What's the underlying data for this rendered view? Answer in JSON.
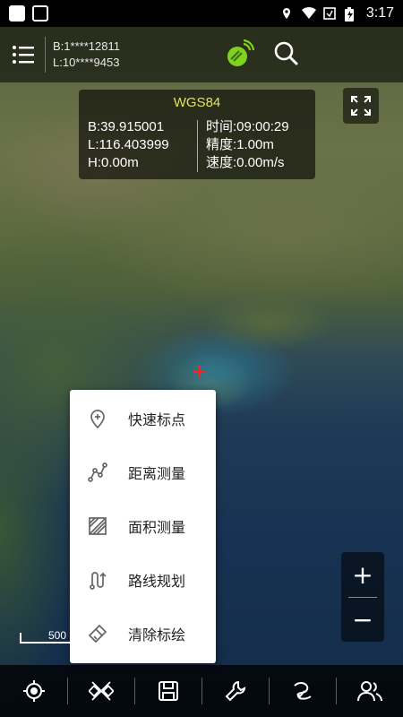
{
  "status_bar": {
    "time": "3:17",
    "icons": [
      "gallery-icon",
      "image-icon",
      "location-icon",
      "wifi-icon",
      "sim-icon",
      "battery-icon"
    ]
  },
  "top_bar": {
    "coord_b": "B:1****12811",
    "coord_l": "L:10****9453",
    "icons": [
      "menu-icon",
      "gps-signal-icon",
      "search-icon"
    ],
    "accent_color": "#7ed321"
  },
  "info_panel": {
    "datum": "WGS84",
    "latitude": "B:39.915001",
    "longitude": "L:116.403999",
    "height": "H:0.00m",
    "time": "时间:09:00:29",
    "accuracy": "精度:1.00m",
    "speed": "速度:0.00m/s",
    "title_color": "#e6e15a"
  },
  "popup_menu": {
    "items": [
      {
        "label": "快速标点",
        "icon": "pin-add-icon"
      },
      {
        "label": "距离测量",
        "icon": "distance-measure-icon"
      },
      {
        "label": "面积测量",
        "icon": "area-measure-icon"
      },
      {
        "label": "路线规划",
        "icon": "route-plan-icon"
      },
      {
        "label": "清除标绘",
        "icon": "clear-brush-icon"
      }
    ]
  },
  "zoom": {
    "in_label": "+",
    "out_label": "−"
  },
  "scale": {
    "label": "500"
  },
  "bottom_bar": {
    "icons": [
      "locate-icon",
      "tools-cross-icon",
      "save-icon",
      "wrench-icon",
      "track-icon",
      "users-icon"
    ]
  }
}
